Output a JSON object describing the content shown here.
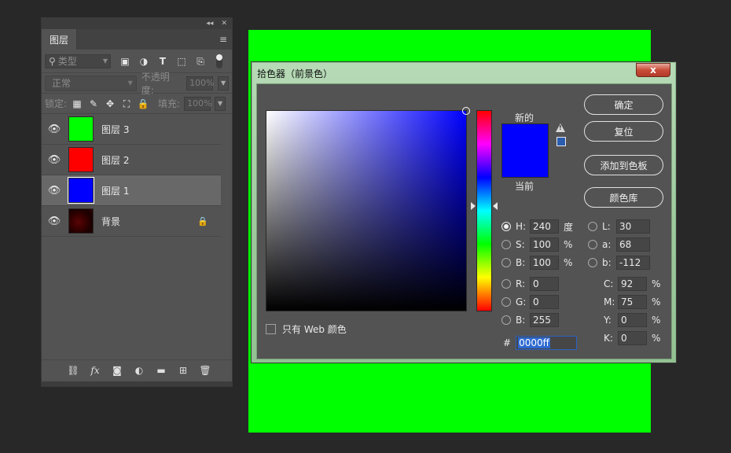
{
  "colors": {
    "canvas": "#00ff00",
    "picked": "#0000ff",
    "accent": "#2e6ad1"
  },
  "panel": {
    "top_icons": [
      "collapse-icon",
      "close-icon"
    ],
    "tab": "图层",
    "filter_kind": "类型",
    "blend_mode": "正常",
    "opacity_label": "不透明度:",
    "opacity_value": "100%",
    "lock_label": "锁定:",
    "fill_label": "填充:",
    "fill_value": "100%",
    "layers": [
      {
        "name": "图层 3",
        "color": "#00ff00",
        "visible": true,
        "selected": false
      },
      {
        "name": "图层 2",
        "color": "#ff0000",
        "visible": true,
        "selected": false
      },
      {
        "name": "图层 1",
        "color": "#0000ff",
        "visible": true,
        "selected": true
      },
      {
        "name": "背景",
        "color": "#3a0000",
        "visible": true,
        "selected": false,
        "locked": true
      }
    ],
    "bottom_icons": [
      "link-icon",
      "fx-icon",
      "mask-icon",
      "adjustment-icon",
      "folder-icon",
      "new-layer-icon",
      "trash-icon"
    ],
    "fx_text": "fx"
  },
  "dialog": {
    "title": "拾色器（前景色）",
    "close": "x",
    "new_label": "新的",
    "current_label": "当前",
    "buttons": {
      "ok": "确定",
      "reset": "复位",
      "add_swatch": "添加到色板",
      "libraries": "颜色库"
    },
    "hsb": {
      "h": {
        "label": "H:",
        "value": "240",
        "unit": "度"
      },
      "s": {
        "label": "S:",
        "value": "100",
        "unit": "%"
      },
      "b": {
        "label": "B:",
        "value": "100",
        "unit": "%"
      }
    },
    "lab": {
      "l": {
        "label": "L:",
        "value": "30"
      },
      "a": {
        "label": "a:",
        "value": "68"
      },
      "b": {
        "label": "b:",
        "value": "-112"
      }
    },
    "rgb": {
      "r": {
        "label": "R:",
        "value": "0"
      },
      "g": {
        "label": "G:",
        "value": "0"
      },
      "b": {
        "label": "B:",
        "value": "255"
      }
    },
    "cmyk": {
      "c": {
        "label": "C:",
        "value": "92",
        "unit": "%"
      },
      "m": {
        "label": "M:",
        "value": "75",
        "unit": "%"
      },
      "y": {
        "label": "Y:",
        "value": "0",
        "unit": "%"
      },
      "k": {
        "label": "K:",
        "value": "0",
        "unit": "%"
      }
    },
    "hex_label": "#",
    "hex_value": "0000ff",
    "web_only": "只有 Web 颜色"
  }
}
